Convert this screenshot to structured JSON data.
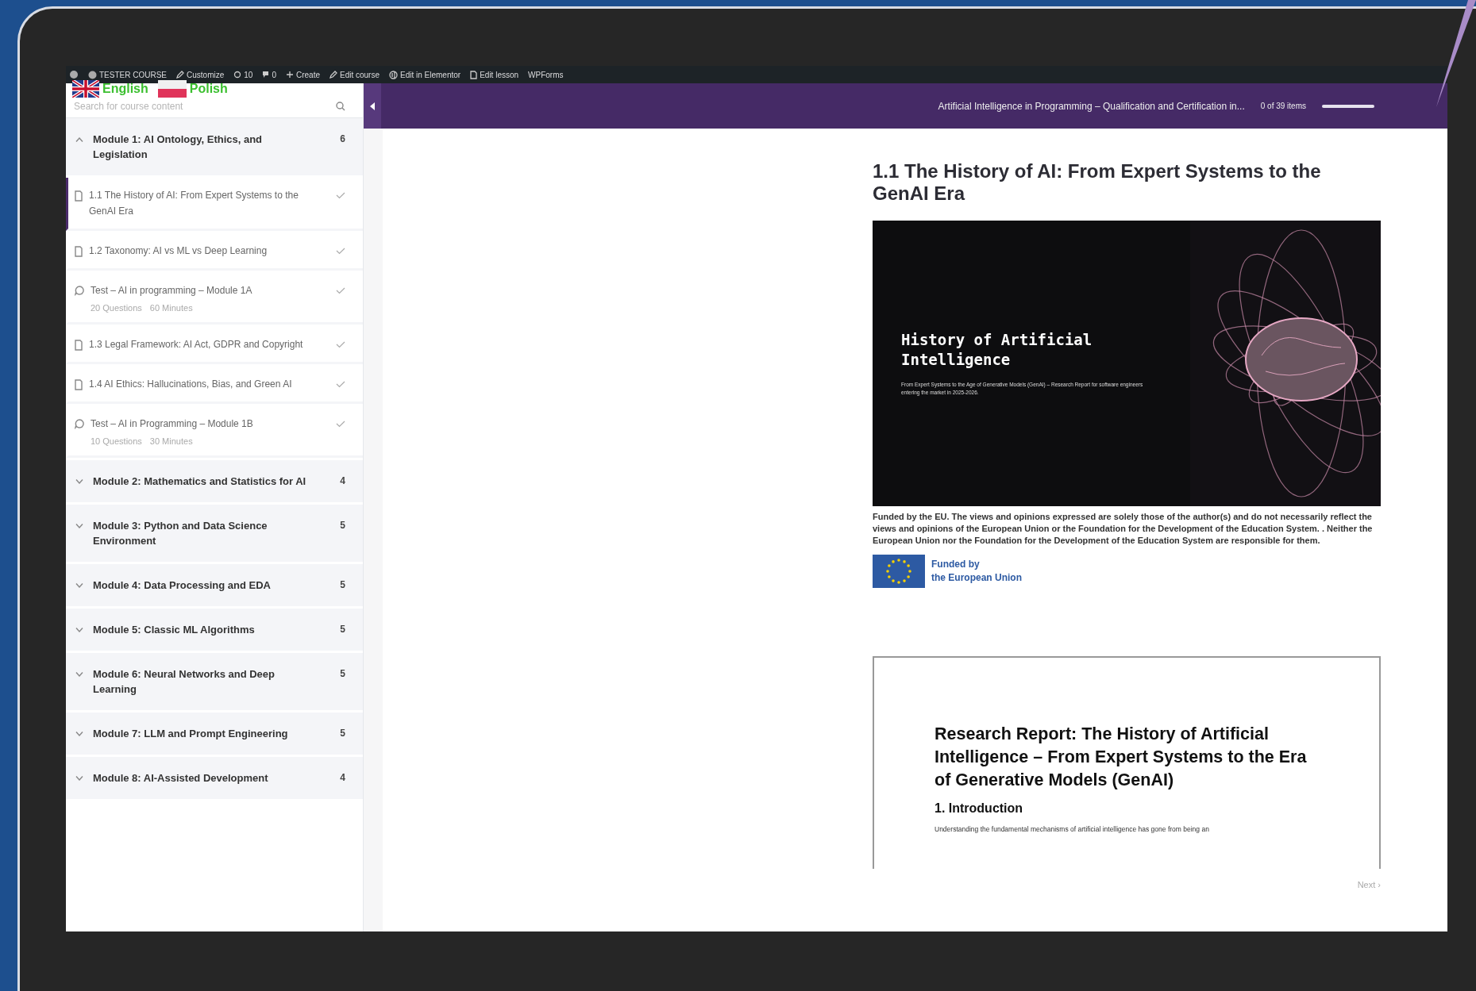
{
  "admin_bar": {
    "site": "TESTER COURSE",
    "items": [
      {
        "kind": "customize",
        "label": "Customize"
      },
      {
        "kind": "updates",
        "label": "10"
      },
      {
        "kind": "comments",
        "label": "0"
      },
      {
        "kind": "create",
        "label": "Create"
      },
      {
        "kind": "edit",
        "label": "Edit course"
      },
      {
        "kind": "elementor",
        "label": "Edit in Elementor"
      },
      {
        "kind": "lesson",
        "label": "Edit lesson"
      },
      {
        "kind": "plain",
        "label": "WPForms"
      }
    ]
  },
  "languages": [
    {
      "label": "English",
      "kind": "uk"
    },
    {
      "label": "Polish",
      "kind": "pl"
    }
  ],
  "search": {
    "placeholder": "Search for course content"
  },
  "modules": [
    {
      "title": "Module 1: AI Ontology, Ethics, and Legislation",
      "count": "6",
      "expanded": true,
      "items": [
        {
          "kind": "lesson",
          "title": "1.1 The History of AI: From Expert Systems to the GenAI Era",
          "completed": true,
          "selected": true
        },
        {
          "kind": "lesson",
          "title": "1.2 Taxonomy: AI vs ML vs Deep Learning",
          "completed": true,
          "selected": false
        },
        {
          "kind": "quiz",
          "title": "Test – AI in programming – Module 1A",
          "meta": [
            "20 Questions",
            "60 Minutes"
          ],
          "completed": true,
          "selected": false
        },
        {
          "kind": "lesson",
          "title": "1.3 Legal Framework: AI Act, GDPR and Copyright",
          "completed": true,
          "selected": false
        },
        {
          "kind": "lesson",
          "title": "1.4 AI Ethics: Hallucinations, Bias, and Green AI",
          "completed": true,
          "selected": false
        },
        {
          "kind": "quiz",
          "title": "Test – AI in Programming – Module 1B",
          "meta": [
            "10 Questions",
            "30 Minutes"
          ],
          "completed": true,
          "selected": false
        }
      ]
    },
    {
      "title": "Module 2: Mathematics and Statistics for AI",
      "count": "4",
      "expanded": false
    },
    {
      "title": "Module 3: Python and Data Science Environment",
      "count": "5",
      "expanded": false
    },
    {
      "title": "Module 4: Data Processing and EDA",
      "count": "5",
      "expanded": false
    },
    {
      "title": "Module 5: Classic ML Algorithms",
      "count": "5",
      "expanded": false
    },
    {
      "title": "Module 6: Neural Networks and Deep Learning",
      "count": "5",
      "expanded": false
    },
    {
      "title": "Module 7: LLM and Prompt Engineering",
      "count": "5",
      "expanded": false
    },
    {
      "title": "Module 8: AI-Assisted Development",
      "count": "4",
      "expanded": false
    }
  ],
  "header": {
    "course_title": "Artificial Intelligence in Programming – Qualification and Certification in...",
    "progress_text": "0 of 39 items",
    "level": 0
  },
  "lesson": {
    "title": "1.1 The History of AI: From Expert Systems to the GenAI Era",
    "slide": {
      "title": "History of Artificial Intelligence",
      "subtitle": "From Expert Systems to the Age of Generative Models (GenAI) – Research Report for software engineers entering the market in 2025-2026."
    },
    "disclaimer": "Funded by the EU. The views and opinions expressed are solely those of the author(s) and do not necessarily reflect the views and opinions of the European Union or the Foundation for the Development of the Education System. . Neither the European Union nor the Foundation for the Development of the Education System are responsible for them.",
    "eu_logo": [
      "Funded by",
      "the European Union"
    ],
    "document": {
      "title": "Research Report: The History of Artificial Intelligence – From Expert Systems to the Era of Generative Models (GenAI)",
      "section": "1. Introduction",
      "text": "Understanding the fundamental mechanisms of artificial intelligence has gone from being an"
    },
    "next": "Next ›"
  }
}
